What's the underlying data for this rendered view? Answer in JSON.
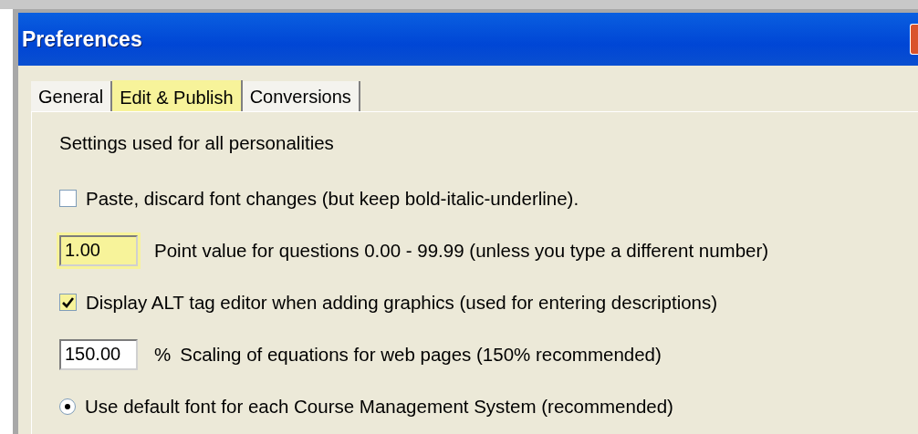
{
  "window": {
    "title": "Preferences"
  },
  "tabs": [
    {
      "label": "General",
      "selected": false,
      "highlighted": false
    },
    {
      "label": "Edit & Publish",
      "selected": true,
      "highlighted": true
    },
    {
      "label": "Conversions",
      "selected": false,
      "highlighted": false
    }
  ],
  "heading": "Settings used for all personalities",
  "options": [
    {
      "kind": "checkbox",
      "text": "Paste, discard font changes (but keep bold-italic-underline).",
      "checked": false,
      "highlighted": false
    },
    {
      "kind": "number",
      "field": {
        "value": "1.00",
        "highlighted": true
      },
      "text": "Point value for questions 0.00 - 99.99  (unless you type a different number)"
    },
    {
      "kind": "checkbox",
      "text": "Display ALT tag editor when adding graphics (used for entering descriptions)",
      "checked": true,
      "highlighted": true
    },
    {
      "kind": "number",
      "field": {
        "value": "150.00",
        "highlighted": false
      },
      "unit": "%",
      "text": "Scaling of equations for web pages (150% recommended)"
    },
    {
      "kind": "radio",
      "text": "Use default font for each Course Management System (recommended)",
      "selected": true
    }
  ]
}
